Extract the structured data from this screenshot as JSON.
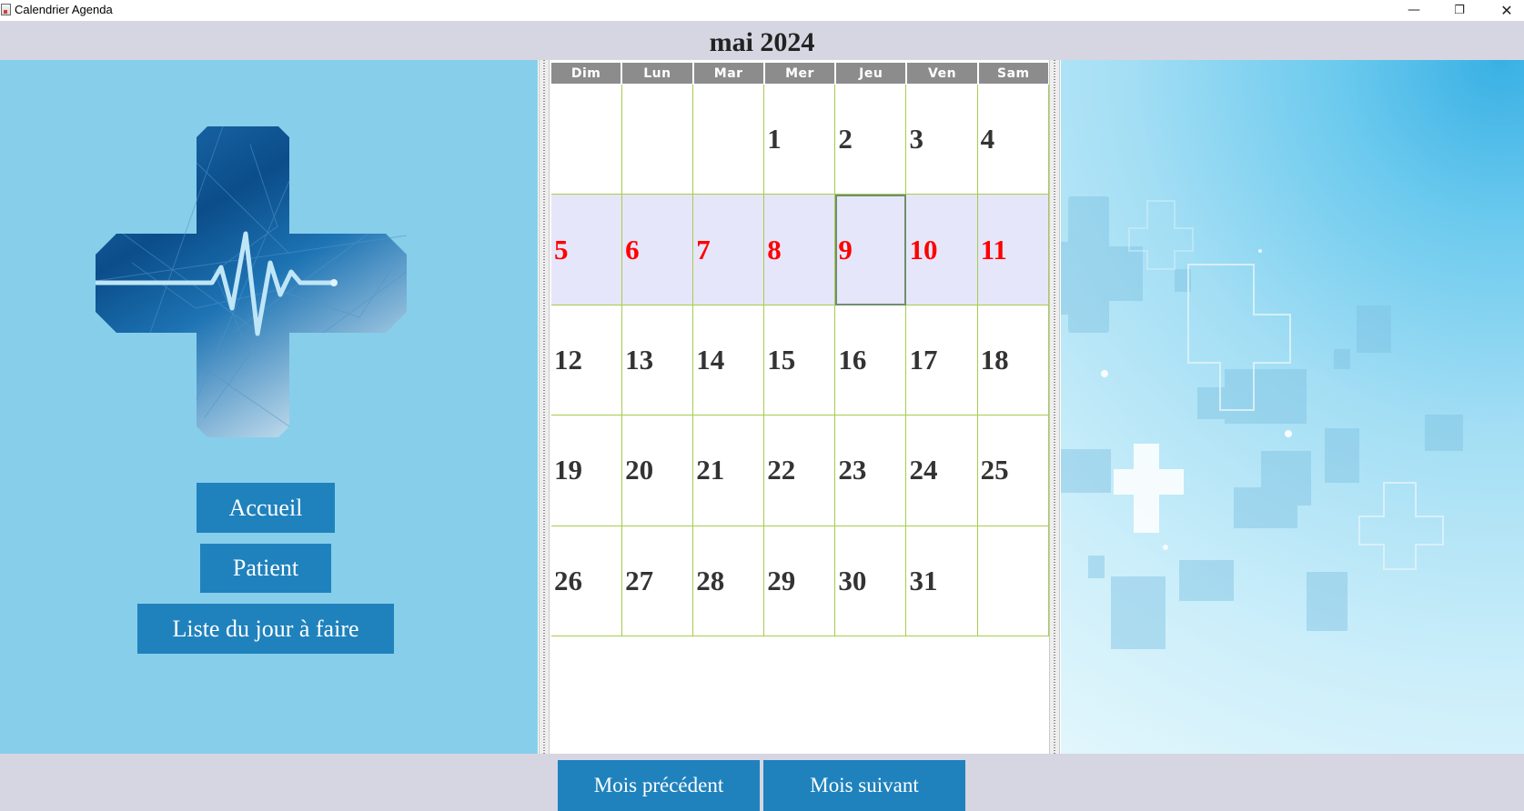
{
  "window": {
    "title": "Calendrier Agenda",
    "minimize_icon": "minimize-icon",
    "maximize_icon": "restore-icon",
    "close_icon": "close-icon",
    "minimize_glyph": "—",
    "restore_glyph": "❐",
    "close_glyph": "✕"
  },
  "header": {
    "month_label": "mai 2024"
  },
  "sidebar": {
    "logo_icon": "medical-cross-heartbeat-icon",
    "buttons": [
      {
        "label": "Accueil"
      },
      {
        "label": "Patient"
      },
      {
        "label": "Liste du jour à faire"
      }
    ],
    "background_color": "#87ceeb",
    "button_color": "#1f82bd"
  },
  "calendar": {
    "weekdays": [
      "Dim",
      "Lun",
      "Mar",
      "Mer",
      "Jeu",
      "Ven",
      "Sam"
    ],
    "weeks": [
      [
        "",
        "",
        "",
        "1",
        "2",
        "3",
        "4"
      ],
      [
        "5",
        "6",
        "7",
        "8",
        "9",
        "10",
        "11"
      ],
      [
        "12",
        "13",
        "14",
        "15",
        "16",
        "17",
        "18"
      ],
      [
        "19",
        "20",
        "21",
        "22",
        "23",
        "24",
        "25"
      ],
      [
        "26",
        "27",
        "28",
        "29",
        "30",
        "31",
        ""
      ]
    ],
    "highlighted_week_index": 1,
    "selected_day": "9",
    "highlight_text_color": "#ff0000",
    "highlight_background_color": "#e6e6fa",
    "grid_line_color": "#a6cc4e"
  },
  "right_panel": {
    "image_icon": "medical-crosses-background-icon"
  },
  "footer": {
    "previous_label": "Mois précédent",
    "next_label": "Mois suivant"
  }
}
